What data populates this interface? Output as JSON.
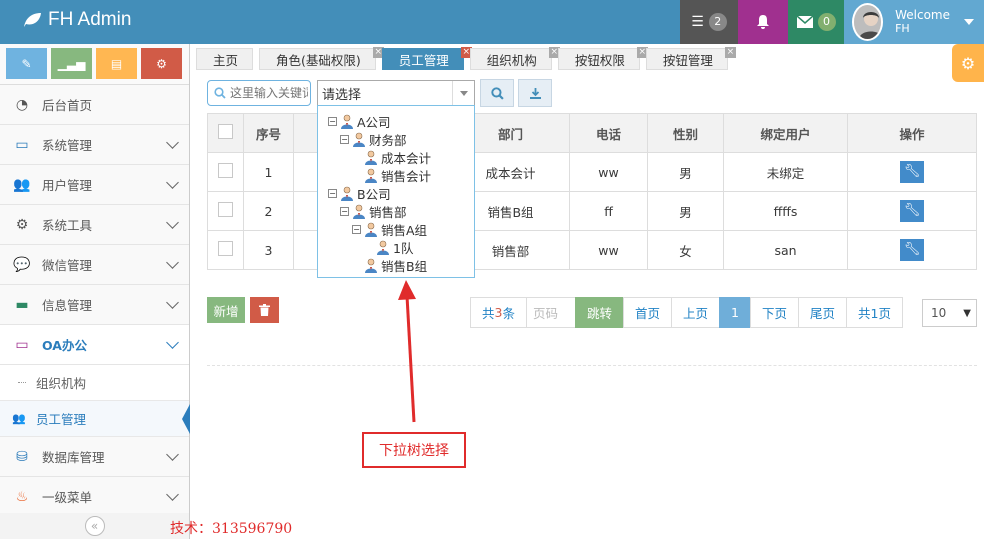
{
  "header": {
    "brand": "FH Admin",
    "task_count": "2",
    "mail_count": "0",
    "welcome": "Welcome",
    "username": "FH"
  },
  "sidebar": {
    "items": [
      {
        "label": "后台首页",
        "icon": "dashboard-icon"
      },
      {
        "label": "系统管理",
        "icon": "desktop-icon"
      },
      {
        "label": "用户管理",
        "icon": "users-icon"
      },
      {
        "label": "系统工具",
        "icon": "gear-icon"
      },
      {
        "label": "微信管理",
        "icon": "chat-icon"
      },
      {
        "label": "信息管理",
        "icon": "card-icon"
      },
      {
        "label": "OA办公",
        "icon": "laptop-icon"
      }
    ],
    "sub_items": [
      {
        "label": "组织机构"
      },
      {
        "label": "员工管理"
      }
    ],
    "items_after": [
      {
        "label": "数据库管理",
        "icon": "hdd-icon"
      },
      {
        "label": "一级菜单",
        "icon": "fire-icon"
      }
    ],
    "collapse_glyph": "«"
  },
  "tabs": [
    {
      "label": "主页"
    },
    {
      "label": "角色(基础权限)"
    },
    {
      "label": "员工管理"
    },
    {
      "label": "组织机构"
    },
    {
      "label": "按钮权限"
    },
    {
      "label": "按钮管理"
    }
  ],
  "toolbar": {
    "search_placeholder": "这里输入关键词",
    "select_value": "请选择"
  },
  "tree": [
    {
      "label": "A公司",
      "level": 0,
      "toggle": "−"
    },
    {
      "label": "财务部",
      "level": 1,
      "toggle": "−"
    },
    {
      "label": "成本会计",
      "level": 2,
      "toggle": ""
    },
    {
      "label": "销售会计",
      "level": 2,
      "toggle": ""
    },
    {
      "label": "B公司",
      "level": 0,
      "toggle": "−"
    },
    {
      "label": "销售部",
      "level": 1,
      "toggle": "−"
    },
    {
      "label": "销售A组",
      "level": 2,
      "toggle": "−"
    },
    {
      "label": "1队",
      "level": 3,
      "toggle": ""
    },
    {
      "label": "销售B组",
      "level": 2,
      "toggle": ""
    }
  ],
  "table": {
    "headers": [
      "序号",
      "",
      "部门",
      "电话",
      "性别",
      "绑定用户",
      "操作"
    ],
    "rows": [
      {
        "no": "1",
        "dept": "成本会计",
        "phone": "ww",
        "sex": "男",
        "bind": "未绑定"
      },
      {
        "no": "2",
        "dept": "销售B组",
        "phone": "ff",
        "sex": "男",
        "bind": "ffffs"
      },
      {
        "no": "3",
        "dept": "销售部",
        "phone": "ww",
        "sex": "女",
        "bind": "san"
      }
    ]
  },
  "actions": {
    "add": "新增"
  },
  "pager": {
    "total_prefix": "共",
    "total_count": "3",
    "total_suffix": "条",
    "page_input_placeholder": "页码",
    "go": "跳转",
    "first": "首页",
    "prev": "上页",
    "current": "1",
    "next": "下页",
    "last": "尾页",
    "pages": "共1页",
    "page_size": "10"
  },
  "annotation": {
    "note": "下拉树选择",
    "tech": "技术：313596790"
  },
  "colors": {
    "header": "#438eb9",
    "accent_red": "#e02b2b",
    "green": "#87b87f",
    "danger": "#d15b47"
  }
}
